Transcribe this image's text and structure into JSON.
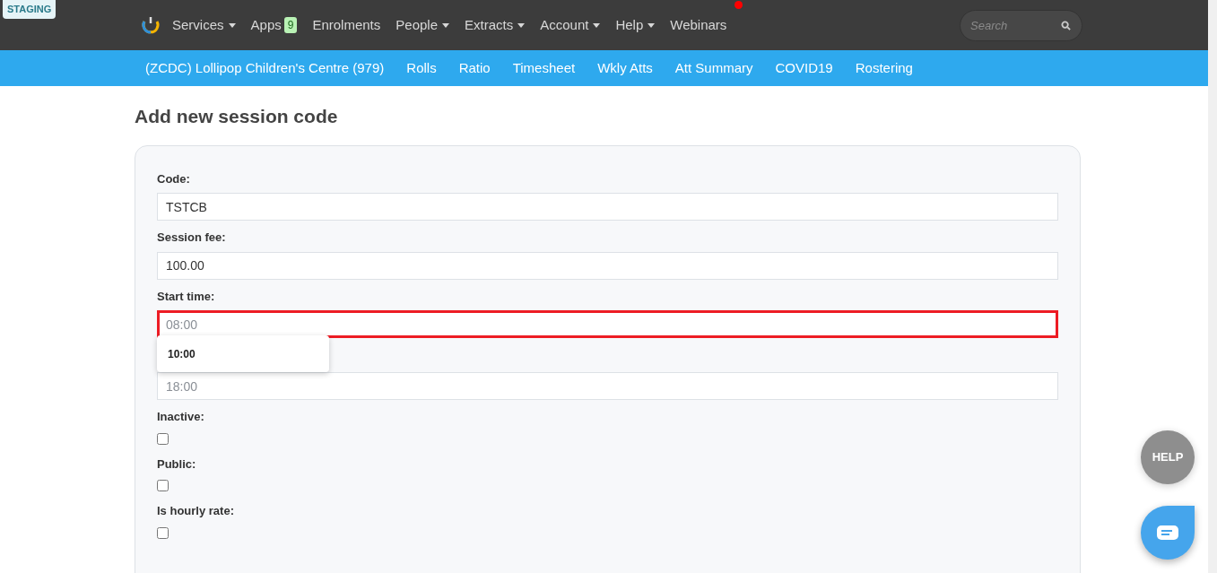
{
  "env_badge": "STAGING",
  "nav": [
    {
      "label": "Services",
      "has_menu": true
    },
    {
      "label": "Apps",
      "has_menu": false,
      "badge": "9"
    },
    {
      "label": "Enrolments",
      "has_menu": false
    },
    {
      "label": "People",
      "has_menu": true
    },
    {
      "label": "Extracts",
      "has_menu": true
    },
    {
      "label": "Account",
      "has_menu": true
    },
    {
      "label": "Help",
      "has_menu": true
    },
    {
      "label": "Webinars",
      "has_menu": false,
      "notification": true
    }
  ],
  "search": {
    "placeholder": "Search"
  },
  "subnav": [
    "(ZCDC) Lollipop Children's Centre (979)",
    "Rolls",
    "Ratio",
    "Timesheet",
    "Wkly Atts",
    "Att Summary",
    "COVID19",
    "Rostering"
  ],
  "page_title": "Add new session code",
  "fields": [
    {
      "kind": "text",
      "label": "Code:",
      "value": "TSTCB",
      "highlighted": false
    },
    {
      "kind": "text",
      "label": "Session fee:",
      "value": "100.00",
      "highlighted": false
    },
    {
      "kind": "text",
      "label": "Start time:",
      "placeholder": "08:00",
      "highlighted": true,
      "suggestions": [
        "10:00"
      ]
    },
    {
      "kind": "text",
      "placeholder": "18:00",
      "highlighted": false
    },
    {
      "kind": "checkbox",
      "label": "Inactive:",
      "checked": false
    },
    {
      "kind": "checkbox",
      "label": "Public:",
      "checked": false
    },
    {
      "kind": "checkbox",
      "label": "Is hourly rate:",
      "checked": false
    }
  ],
  "help_button": "HELP"
}
